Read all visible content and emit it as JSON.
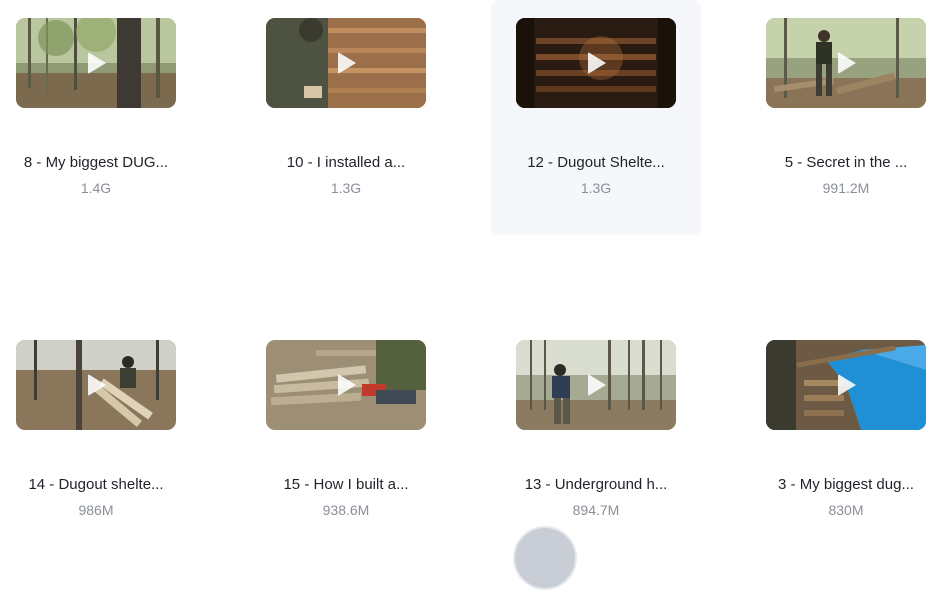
{
  "files": [
    {
      "name": "8 - My biggest DUG...",
      "size": "1.4G",
      "scene": "forest",
      "selected": false
    },
    {
      "name": "10 - I installed a...",
      "size": "1.3G",
      "scene": "interior-man",
      "selected": false
    },
    {
      "name": "12 - Dugout Shelte...",
      "size": "1.3G",
      "scene": "dark-cabin",
      "selected": true
    },
    {
      "name": "5 - Secret in the ...",
      "size": "991.2M",
      "scene": "log-worker",
      "selected": false
    },
    {
      "name": "14 - Dugout shelte...",
      "size": "986M",
      "scene": "planks",
      "selected": false
    },
    {
      "name": "15 - How I built a...",
      "size": "938.6M",
      "scene": "chainsaw",
      "selected": false
    },
    {
      "name": "13 - Underground h...",
      "size": "894.7M",
      "scene": "forest-worker",
      "selected": false
    },
    {
      "name": "3 - My biggest dug...",
      "size": "830M",
      "scene": "tarp",
      "selected": false
    }
  ],
  "icons": {
    "play": "play-icon",
    "avatar": "avatar"
  },
  "colors": {
    "selected_background": "#f5f7fb",
    "title_text": "#1f2329",
    "size_text": "#8a8f99"
  }
}
